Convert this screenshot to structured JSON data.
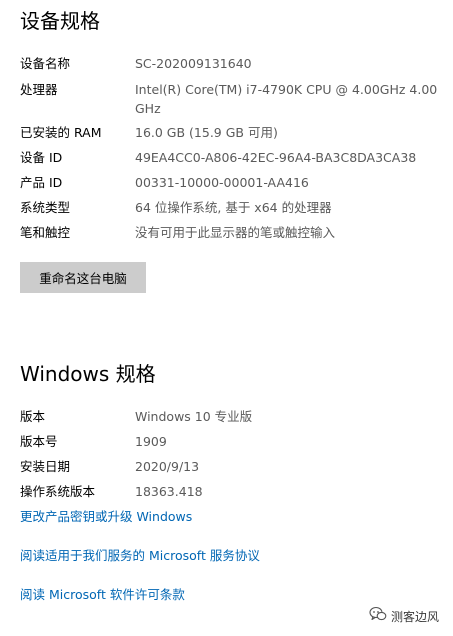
{
  "device_specs": {
    "title": "设备规格",
    "rows": [
      {
        "label": "设备名称",
        "value": "SC-202009131640"
      },
      {
        "label": "处理器",
        "value": "Intel(R) Core(TM) i7-4790K CPU @ 4.00GHz   4.00\nGHz"
      },
      {
        "label": "已安装的 RAM",
        "value": "16.0 GB (15.9 GB 可用)"
      },
      {
        "label": "设备 ID",
        "value": "49EA4CC0-A806-42EC-96A4-BA3C8DA3CA38"
      },
      {
        "label": "产品 ID",
        "value": "00331-10000-00001-AA416"
      },
      {
        "label": "系统类型",
        "value": "64 位操作系统, 基于 x64 的处理器"
      },
      {
        "label": "笔和触控",
        "value": "没有可用于此显示器的笔或触控输入"
      }
    ],
    "rename_button": "重命名这台电脑"
  },
  "windows_specs": {
    "title": "Windows 规格",
    "rows": [
      {
        "label": "版本",
        "value": "Windows 10 专业版"
      },
      {
        "label": "版本号",
        "value": "1909"
      },
      {
        "label": "安装日期",
        "value": "2020/9/13"
      },
      {
        "label": "操作系统版本",
        "value": "18363.418"
      }
    ]
  },
  "links": {
    "change_product_key": "更改产品密钥或升级 Windows",
    "service_agreement": "阅读适用于我们服务的 Microsoft 服务协议",
    "license_terms": "阅读 Microsoft 软件许可条款"
  },
  "watermark": {
    "text": "测客边风",
    "icon": "wechat-icon"
  },
  "colors": {
    "link": "#0066b4",
    "value_text": "#5a5a5a",
    "button_bg": "#cccccc"
  }
}
